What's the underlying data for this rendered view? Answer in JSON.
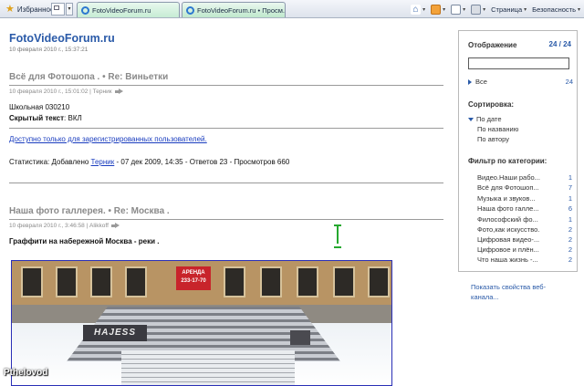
{
  "toolbar": {
    "favorites_label": "Избранное",
    "tabs": [
      {
        "label": "FotoVideoForum.ru",
        "close": "×"
      },
      {
        "label": "FotoVideoForum.ru • Просм...",
        "close": "×"
      }
    ],
    "page_menu": "Страница",
    "safety_menu": "Безопасность"
  },
  "site": {
    "title": "FotoVideoForum.ru",
    "date": "10 февраля 2010 г., 15:37:21"
  },
  "posts": [
    {
      "title": "Всё для Фотошопа . • Re: Виньетки",
      "meta": "10 февраля 2010 г., 15:01:02 | Терник",
      "line1": "Школьная 030210",
      "hidden_label": "Скрытый текст",
      "hidden_value": ": ВКЛ",
      "registered_link": "Доступно только для зарегистрированных пользователей.",
      "stats_prefix": "Статистика: Добавлено ",
      "stats_author": "Терник",
      "stats_suffix": " - 07 дек 2009, 14:35 - Ответов 23 - Просмотров 660"
    },
    {
      "title": "Наша фото галлерея. • Re: Москва .",
      "meta": "10 февраля 2010 г., 3:46:58 | Alikkoff",
      "caption": "Граффити на набережной Москва - реки .",
      "photo_sign": "АРЕНДА 233-17-70",
      "photo_graffiti": "HAJESS"
    }
  ],
  "watermark": "Pthelovod",
  "panel": {
    "display_heading": "Отображение",
    "display_count": "24 / 24",
    "all_label": "Все",
    "all_count": "24",
    "sort_heading": "Сортировка:",
    "sort_options": [
      "По дате",
      "По названию",
      "По автору"
    ],
    "filter_heading": "Фильтр по категории:",
    "categories": [
      {
        "name": "Видео.Наши рабо...",
        "count": "1"
      },
      {
        "name": "Всё для Фотошоп...",
        "count": "7"
      },
      {
        "name": "Музыка и звуков...",
        "count": "1"
      },
      {
        "name": "Наша фото галле...",
        "count": "6"
      },
      {
        "name": "Философский фо...",
        "count": "1"
      },
      {
        "name": "Фото,как искусство.",
        "count": "2"
      },
      {
        "name": "Цифровая видео-...",
        "count": "2"
      },
      {
        "name": "Цифровое и плён...",
        "count": "2"
      },
      {
        "name": "Что наша жизнь -...",
        "count": "2"
      }
    ],
    "properties_link": "Показать свойства веб-канала..."
  }
}
